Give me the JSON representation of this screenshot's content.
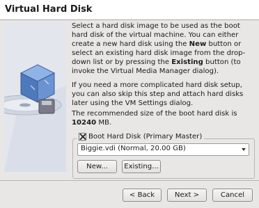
{
  "dialog": {
    "title": "Virtual Hard Disk"
  },
  "content": {
    "p1_a": "Select a hard disk image to be used as the boot hard disk of the virtual machine. You can either create a new hard disk using the ",
    "p1_new": "New",
    "p1_b": " button or select an existing hard disk image from the drop-down list or by pressing the ",
    "p1_existing": "Existing",
    "p1_c": " button (to invoke the Virtual Media Manager dialog).",
    "p2": "If you need a more complicated hard disk setup, you can also skip this step and attach hard disks later using the VM Settings dialog.",
    "p3_a": "The recommended size of the boot hard disk is ",
    "p3_size": "10240",
    "p3_b": " MB."
  },
  "boot_disk": {
    "checkbox_label": "Boot Hard Disk (Primary Master)",
    "checked": true,
    "selected_disk": "Biggie.vdi (Normal, 20.00 GB)",
    "new_button": "New...",
    "existing_button": "Existing..."
  },
  "footer": {
    "back_button": "< Back",
    "next_button": "Next >",
    "cancel_button": "Cancel"
  },
  "icons": {
    "wizard_art": "virtualbox-cube-disk-icon",
    "checkbox": "checkbox-checked-icon",
    "dropdown": "chevron-down-icon"
  }
}
